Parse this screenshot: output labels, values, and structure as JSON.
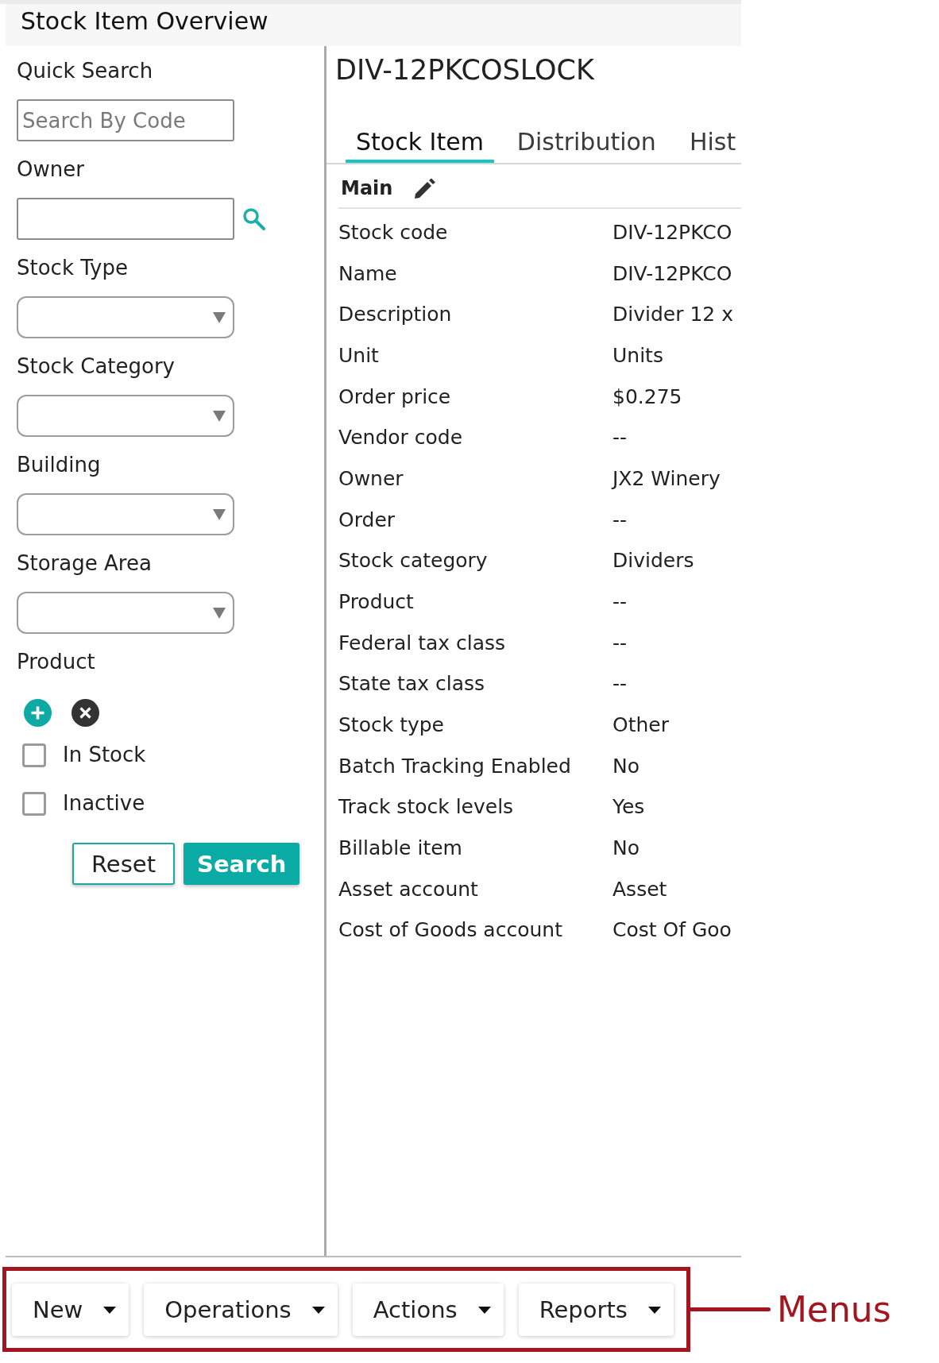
{
  "header": {
    "title": "Stock Item Overview"
  },
  "search_panel": {
    "fields": [
      {
        "kind": "text",
        "label": "Quick Search",
        "placeholder": "Search By Code"
      },
      {
        "kind": "lookup",
        "label": "Owner"
      },
      {
        "kind": "select",
        "label": "Stock Type"
      },
      {
        "kind": "select",
        "label": "Stock Category"
      },
      {
        "kind": "select",
        "label": "Building"
      },
      {
        "kind": "select",
        "label": "Storage Area"
      },
      {
        "kind": "picker",
        "label": "Product"
      }
    ],
    "checkboxes": [
      {
        "label": "In Stock",
        "checked": false
      },
      {
        "label": "Inactive",
        "checked": false
      }
    ],
    "buttons": [
      {
        "kind": "secondary",
        "label": "Reset"
      },
      {
        "kind": "primary",
        "label": "Search"
      }
    ]
  },
  "detail": {
    "title": "DIV-12PKCOSLOCK",
    "tabs": [
      {
        "label": "Stock Item",
        "selected": true
      },
      {
        "label": "Distribution",
        "selected": false
      },
      {
        "label": "Hist",
        "selected": false
      }
    ],
    "section": {
      "title": "Main"
    },
    "rows": [
      {
        "label": "Stock code",
        "value": "DIV-12PKCO"
      },
      {
        "label": "Name",
        "value": "DIV-12PKCO"
      },
      {
        "label": "Description",
        "value": "Divider 12 x"
      },
      {
        "label": "Unit",
        "value": "Units"
      },
      {
        "label": "Order price",
        "value": "$0.275"
      },
      {
        "label": "Vendor code",
        "value": "--"
      },
      {
        "label": "Owner",
        "value": "JX2 Winery"
      },
      {
        "label": "Order",
        "value": "--"
      },
      {
        "label": "Stock category",
        "value": "Dividers"
      },
      {
        "label": "Product",
        "value": "--"
      },
      {
        "label": "Federal tax class",
        "value": "--"
      },
      {
        "label": "State tax class",
        "value": "--"
      },
      {
        "label": "Stock type",
        "value": "Other"
      },
      {
        "label": "Batch Tracking Enabled",
        "value": "No"
      },
      {
        "label": "Track stock levels",
        "value": "Yes"
      },
      {
        "label": "Billable item",
        "value": "No"
      },
      {
        "label": "Asset account",
        "value": "Asset"
      },
      {
        "label": "Cost of Goods account",
        "value": "Cost Of Goo"
      }
    ]
  },
  "menus": [
    "New",
    "Operations",
    "Actions",
    "Reports"
  ],
  "callout": {
    "label": "Menus"
  }
}
